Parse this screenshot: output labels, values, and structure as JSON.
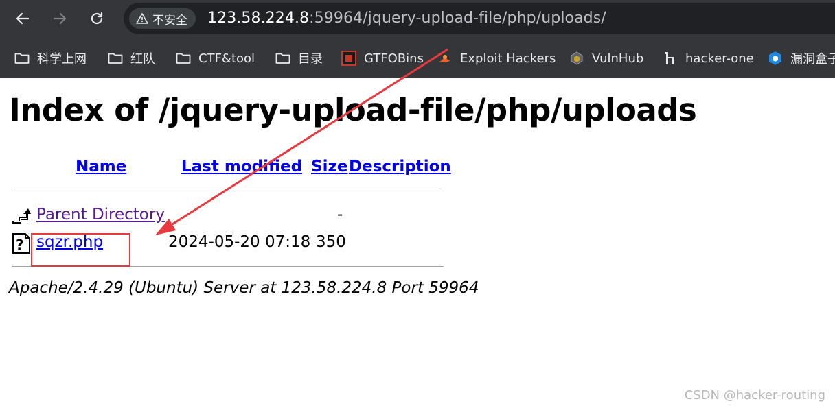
{
  "browser": {
    "security_label": "不安全",
    "url_host": "123.58.224.8",
    "url_rest": ":59964/jquery-upload-file/php/uploads/",
    "bookmarks": [
      {
        "label": "科学上网",
        "icon": "folder-icon"
      },
      {
        "label": "红队",
        "icon": "folder-icon"
      },
      {
        "label": "CTF&tool",
        "icon": "folder-icon"
      },
      {
        "label": "目录",
        "icon": "folder-icon"
      },
      {
        "label": "GTFOBins",
        "icon": "gtfobins-icon"
      },
      {
        "label": "Exploit Hackers",
        "icon": "exploit-hackers-icon"
      },
      {
        "label": "VulnHub",
        "icon": "vulnhub-icon"
      },
      {
        "label": "hacker-one",
        "icon": "hackerone-icon"
      },
      {
        "label": "漏洞盒子",
        "icon": "vulbox-icon"
      }
    ]
  },
  "page": {
    "title": "Index of /jquery-upload-file/php/uploads",
    "columns": {
      "name": "Name",
      "last_modified": "Last modified",
      "size": "Size",
      "description": "Description"
    },
    "rows": [
      {
        "name": "Parent Directory",
        "last_modified": "",
        "size": "-",
        "icon": "parent-directory-icon"
      },
      {
        "name": "sqzr.php",
        "last_modified": "2024-05-20 07:18",
        "size": "350",
        "icon": "unknown-file-icon"
      }
    ],
    "footer": "Apache/2.4.29 (Ubuntu) Server at 123.58.224.8 Port 59964"
  },
  "annotation": {
    "color": "#e8393f"
  },
  "watermark": "CSDN @hacker-routing"
}
